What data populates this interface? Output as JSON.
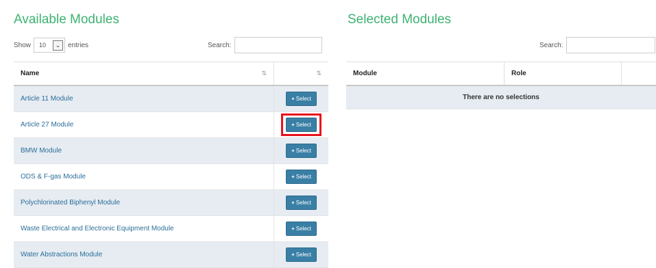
{
  "available": {
    "title": "Available Modules",
    "show_label": "Show",
    "entries_value": "10",
    "entries_label": "entries",
    "search_label": "Search:",
    "search_value": "",
    "columns": [
      "Name",
      ""
    ],
    "select_label": "Select",
    "rows": [
      {
        "name": "Article 11 Module"
      },
      {
        "name": "Article 27 Module"
      },
      {
        "name": "BMW Module"
      },
      {
        "name": "ODS & F-gas Module"
      },
      {
        "name": "Polychlorinated Biphenyl Module"
      },
      {
        "name": "Waste Electrical and Electronic Equipment Module"
      },
      {
        "name": "Water Abstractions Module"
      }
    ]
  },
  "selected": {
    "title": "Selected Modules",
    "search_label": "Search:",
    "search_value": "",
    "columns": [
      "Module",
      "Role",
      ""
    ],
    "empty_text": "There are no selections"
  },
  "colors": {
    "heading": "#3cb371",
    "button": "#3a7fa5",
    "highlight": "#e8101c",
    "row_alt": "#e6ecf2"
  }
}
